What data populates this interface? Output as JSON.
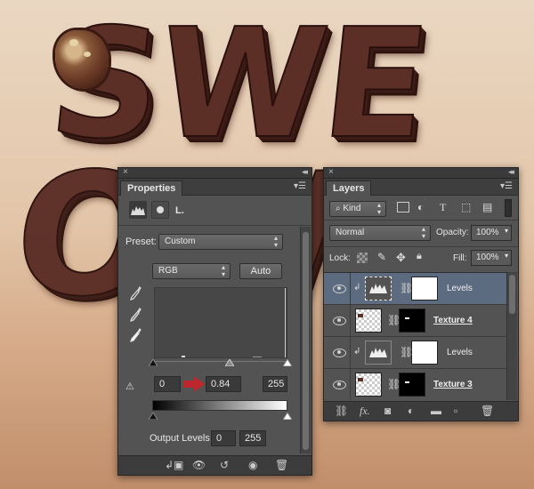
{
  "colors": {
    "panel_bg": "#535353",
    "panel_dark": "#3c3c3c",
    "selected_layer": "#5d6b80",
    "input_arrow": "#c0272d",
    "artwork_chocolate": "#5b2e26"
  },
  "artwork": {
    "top_text": "SWE",
    "bottom_text": "OW"
  },
  "properties": {
    "tab_label": "Properties",
    "adjustment_label": "L.",
    "preset_label": "Preset:",
    "preset_value": "Custom",
    "channel_value": "RGB",
    "auto_label": "Auto",
    "input_shadow": "0",
    "input_midtone": "0.84",
    "input_highlight": "255",
    "output_label": "Output Levels:",
    "output_black": "0",
    "output_white": "255",
    "icons": {
      "levels": "levels-icon",
      "mask": "mask-icon",
      "pipettes": [
        "black-point-eyedropper-icon",
        "gray-point-eyedropper-icon",
        "white-point-eyedropper-icon"
      ],
      "warning": "clipping-warning-icon",
      "footer": [
        "clip-to-layer-icon",
        "view-previous-icon",
        "reset-icon",
        "visibility-icon",
        "trash-icon"
      ]
    }
  },
  "layers": {
    "tab_label": "Layers",
    "filter_kind": "Kind",
    "blend_mode": "Normal",
    "opacity_label": "Opacity:",
    "opacity_value": "100%",
    "lock_label": "Lock:",
    "fill_label": "Fill:",
    "fill_value": "100%",
    "items": [
      {
        "name": "Levels",
        "type": "adjustment",
        "selected": true
      },
      {
        "name": "Texture 4",
        "type": "texture",
        "selected": false
      },
      {
        "name": "Levels",
        "type": "adjustment",
        "selected": false
      },
      {
        "name": "Texture 3",
        "type": "texture",
        "selected": false
      }
    ],
    "footer_icons": [
      "link-layers-icon",
      "fx-icon",
      "add-mask-icon",
      "adjustment-layer-icon",
      "new-group-icon",
      "new-layer-icon",
      "delete-layer-icon"
    ],
    "fx_label": "fx."
  }
}
